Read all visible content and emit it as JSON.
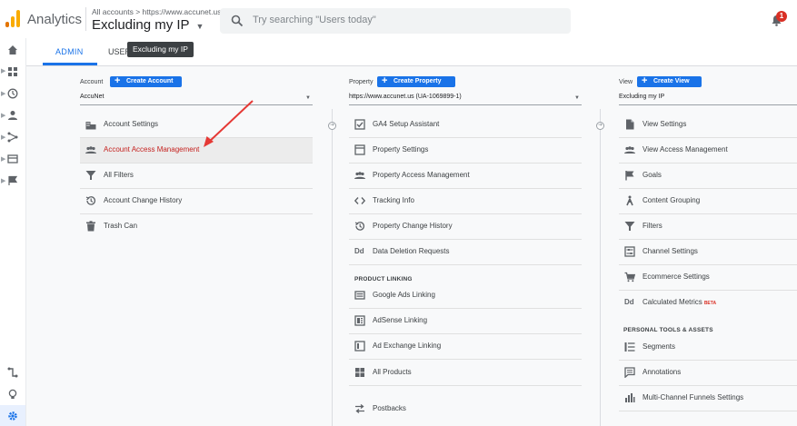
{
  "header": {
    "app_name": "Analytics",
    "account_path": "All accounts > https://www.accunet.us",
    "current_view": "Excluding my IP",
    "search_placeholder": "Try searching \"Users today\"",
    "notification_count": "1"
  },
  "tabs": {
    "admin": "ADMIN",
    "user": "USER",
    "tooltip": "Excluding my IP"
  },
  "account": {
    "label": "Account",
    "create_label": "Create Account",
    "selected": "AccuNet",
    "items": [
      {
        "label": "Account Settings",
        "icon": "building-icon"
      },
      {
        "label": "Account Access Management",
        "icon": "people-icon"
      },
      {
        "label": "All Filters",
        "icon": "filter-icon"
      },
      {
        "label": "Account Change History",
        "icon": "history-icon"
      },
      {
        "label": "Trash Can",
        "icon": "trash-icon"
      }
    ]
  },
  "property": {
    "label": "Property",
    "create_label": "Create Property",
    "selected": "https://www.accunet.us (UA-1069899-1)",
    "items": [
      {
        "label": "GA4 Setup Assistant",
        "icon": "checkbox-icon"
      },
      {
        "label": "Property Settings",
        "icon": "window-icon"
      },
      {
        "label": "Property Access Management",
        "icon": "people-icon"
      },
      {
        "label": "Tracking Info",
        "icon": "code-icon"
      },
      {
        "label": "Property Change History",
        "icon": "history-icon"
      },
      {
        "label": "Data Deletion Requests",
        "icon": "dd-icon"
      }
    ],
    "product_linking_heading": "PRODUCT LINKING",
    "linking_items": [
      {
        "label": "Google Ads Linking",
        "icon": "ads-icon"
      },
      {
        "label": "AdSense Linking",
        "icon": "adsense-icon"
      },
      {
        "label": "Ad Exchange Linking",
        "icon": "adexchange-icon"
      },
      {
        "label": "All Products",
        "icon": "grid-icon"
      },
      {
        "label": "Postbacks",
        "icon": "postbacks-icon"
      }
    ]
  },
  "view": {
    "label": "View",
    "create_label": "Create View",
    "selected": "Excluding my IP",
    "items": [
      {
        "label": "View Settings",
        "icon": "document-icon"
      },
      {
        "label": "View Access Management",
        "icon": "people-icon"
      },
      {
        "label": "Goals",
        "icon": "flag-icon"
      },
      {
        "label": "Content Grouping",
        "icon": "person-walk-icon"
      },
      {
        "label": "Filters",
        "icon": "filter-icon"
      },
      {
        "label": "Channel Settings",
        "icon": "sliders-icon"
      },
      {
        "label": "Ecommerce Settings",
        "icon": "cart-icon"
      },
      {
        "label": "Calculated Metrics",
        "icon": "dd-icon",
        "badge": "BETA"
      }
    ],
    "personal_heading": "PERSONAL TOOLS & ASSETS",
    "personal_items": [
      {
        "label": "Segments",
        "icon": "segments-icon"
      },
      {
        "label": "Annotations",
        "icon": "comment-icon"
      },
      {
        "label": "Multi-Channel Funnels Settings",
        "icon": "bars-icon"
      }
    ]
  },
  "colors": {
    "accent": "#1a73e8",
    "highlight_text": "#c5221f",
    "arrow": "#e53935",
    "logo": "#f9ab00"
  }
}
